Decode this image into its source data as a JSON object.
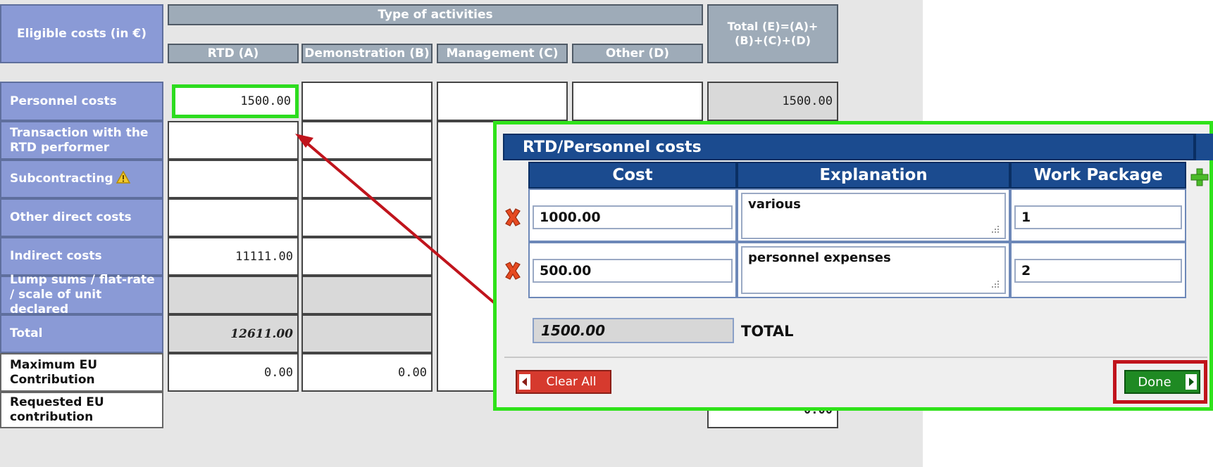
{
  "main_table": {
    "header": {
      "eligible_costs": "Eligible costs (in €)",
      "type_of_activities": "Type of activities",
      "total": "Total (E)=(A)+\n(B)+(C)+(D)",
      "col_a": "RTD (A)",
      "col_b": "Demonstration (B)",
      "col_c": "Management (C)",
      "col_d": "Other (D)"
    },
    "rows": [
      {
        "label": "Personnel costs",
        "a": "1500.00",
        "b": "",
        "c": "",
        "d": "",
        "e": "1500.00"
      },
      {
        "label": "Transaction with the RTD performer",
        "a": "",
        "b": "",
        "c": "",
        "d": "",
        "e": ""
      },
      {
        "label": "Subcontracting",
        "a": "",
        "b": "",
        "c": "",
        "d": "",
        "e": ""
      },
      {
        "label": "Other direct costs",
        "a": "",
        "b": "",
        "c": "",
        "d": "",
        "e": ""
      },
      {
        "label": "Indirect costs",
        "a": "11111.00",
        "b": "",
        "c": "",
        "d": "",
        "e": ""
      },
      {
        "label": "Lump sums / flat-rate / scale of unit declared",
        "a": "",
        "b": "",
        "c": "",
        "d": "",
        "e": ""
      },
      {
        "label": "Total",
        "a": "12611.00",
        "b": "",
        "c": "",
        "d": "",
        "e": ""
      },
      {
        "label": "Maximum EU Contribution",
        "a": "0.00",
        "b": "0.00",
        "c": "",
        "d": "",
        "e": ""
      },
      {
        "label": "Requested EU contribution",
        "a": "",
        "b": "",
        "c": "",
        "d": "",
        "e": "0.00"
      }
    ]
  },
  "popup": {
    "title": "RTD/Personnel costs",
    "columns": [
      "Cost",
      "Explanation",
      "Work Package"
    ],
    "rows": [
      {
        "cost": "1000.00",
        "explanation": "various",
        "work_package": "1"
      },
      {
        "cost": "500.00",
        "explanation": "personnel expenses",
        "work_package": "2"
      }
    ],
    "total_value": "1500.00",
    "total_label": "TOTAL",
    "clear_all_label": "Clear All",
    "done_label": "Done"
  },
  "colors": {
    "highlight_green": "#2ddc1f",
    "highlight_red": "#c0141c",
    "popup_header_blue": "#1b4b8f",
    "row_label_blue": "#8a9ad6"
  }
}
